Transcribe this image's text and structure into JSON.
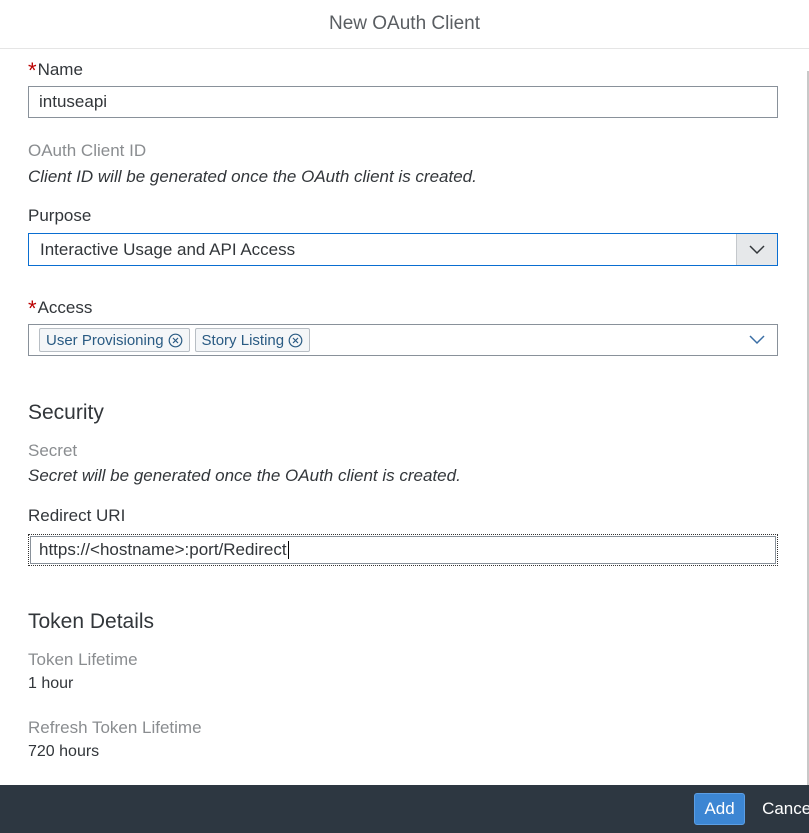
{
  "dialog": {
    "title": "New OAuth Client"
  },
  "form": {
    "name": {
      "label": "Name",
      "required_mark": "*",
      "value": "intuseapi"
    },
    "client_id": {
      "label": "OAuth Client ID",
      "info": "Client ID will be generated once the OAuth client is created."
    },
    "purpose": {
      "label": "Purpose",
      "selected": "Interactive Usage and API Access"
    },
    "access": {
      "label": "Access",
      "required_mark": "*",
      "tokens": [
        {
          "label": "User Provisioning"
        },
        {
          "label": "Story Listing"
        }
      ]
    }
  },
  "security": {
    "title": "Security",
    "secret": {
      "label": "Secret",
      "info": "Secret will be generated once the OAuth client is created."
    },
    "redirect_uri": {
      "label": "Redirect URI",
      "value": "https://<hostname>:port/Redirect"
    }
  },
  "token_details": {
    "title": "Token Details",
    "token_lifetime": {
      "label": "Token Lifetime",
      "value": "1 hour"
    },
    "refresh_token_lifetime": {
      "label": "Refresh Token Lifetime",
      "value": "720 hours"
    }
  },
  "footer": {
    "add_label": "Add",
    "cancel_label": "Cancel"
  },
  "colors": {
    "accent": "#0a6ed1",
    "footer_bg": "#2d3741",
    "required": "#bb0000",
    "button_primary": "#3c86d3"
  }
}
